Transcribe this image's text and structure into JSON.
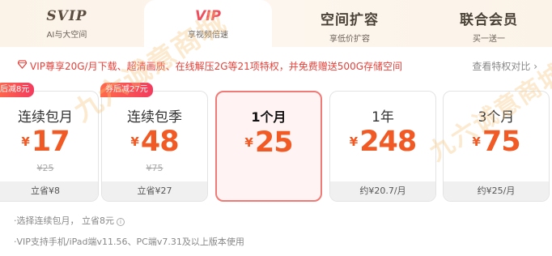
{
  "tabs": [
    {
      "title": "SVIP",
      "subtitle": "AI与大空间"
    },
    {
      "title": "VIP",
      "subtitle": "享视频倍速"
    },
    {
      "title": "空间扩容",
      "subtitle": "享低价扩容"
    },
    {
      "title": "联合会员",
      "subtitle": "买一送一"
    }
  ],
  "active_tab": "VIP",
  "banner": {
    "text": "VIP尊享20G/月下载、超清画质、在线解压2G等21项特权，并免费赠送500G存储空间",
    "link": "查看特权对比 ›"
  },
  "plans": [
    {
      "name": "连续包月",
      "currency": "¥",
      "price": "17",
      "original": "¥25",
      "footer": "立省¥8",
      "tag": "后减8元"
    },
    {
      "name": "连续包季",
      "currency": "¥",
      "price": "48",
      "original": "¥75",
      "footer": "立省¥27",
      "tag": "券后减27元"
    },
    {
      "name": "1个月",
      "currency": "¥",
      "price": "25",
      "original": "",
      "footer": "",
      "tag": ""
    },
    {
      "name": "1年",
      "currency": "¥",
      "price": "248",
      "original": "",
      "footer": "约¥20.7/月",
      "tag": ""
    },
    {
      "name": "3个月",
      "currency": "¥",
      "price": "75",
      "original": "",
      "footer": "约¥25/月",
      "tag": ""
    }
  ],
  "selected_plan": "1个月",
  "notes": {
    "selection": "·选择连续包月， 立省8元",
    "info_icon": "i",
    "support": "·VIP支持手机/iPad端v11.56、PC端v7.31及以上版本使用"
  },
  "watermark": "九六诚意商城",
  "colors": {
    "accent": "#ef4f5c",
    "price": "#f15a24",
    "selected_border": "#f07a76"
  }
}
